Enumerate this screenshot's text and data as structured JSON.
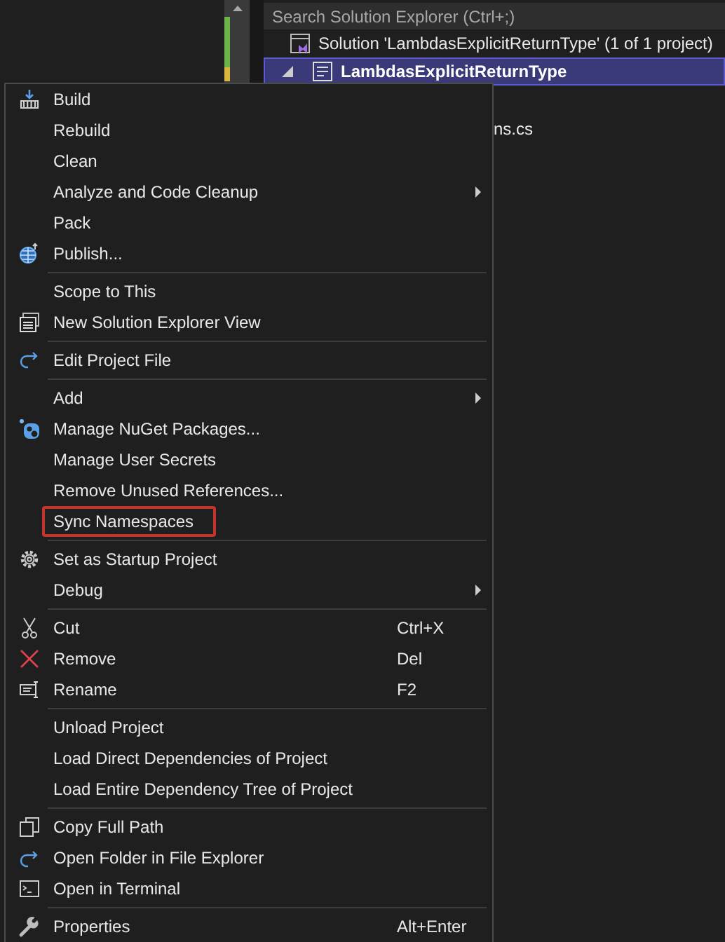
{
  "solution_explorer": {
    "search": {
      "placeholder": "Search Solution Explorer (Ctrl+;)"
    },
    "tree": [
      {
        "kind": "solution",
        "label": "Solution 'LambdasExplicitReturnType' (1 of 1 project)",
        "selected": false
      },
      {
        "kind": "project",
        "label": "LambdasExplicitReturnType",
        "selected": true,
        "expanded": true
      },
      {
        "kind": "file",
        "label": "ns.cs",
        "selected": false
      }
    ]
  },
  "context_menu": {
    "groups": [
      [
        {
          "label": "Build",
          "submenu": false,
          "outlined": false
        },
        {
          "label": "Rebuild",
          "submenu": false,
          "outlined": false
        },
        {
          "label": "Clean",
          "submenu": false,
          "outlined": false
        },
        {
          "label": "Analyze and Code Cleanup",
          "submenu": true,
          "outlined": false
        },
        {
          "label": "Pack",
          "submenu": false,
          "outlined": false
        },
        {
          "label": "Publish...",
          "submenu": false,
          "outlined": false
        }
      ],
      [
        {
          "label": "Scope to This",
          "submenu": false,
          "outlined": false
        },
        {
          "label": "New Solution Explorer View",
          "submenu": false,
          "outlined": false
        }
      ],
      [
        {
          "label": "Edit Project File",
          "submenu": false,
          "outlined": false
        }
      ],
      [
        {
          "label": "Add",
          "submenu": true,
          "outlined": false
        },
        {
          "label": "Manage NuGet Packages...",
          "submenu": false,
          "outlined": false
        },
        {
          "label": "Manage User Secrets",
          "submenu": false,
          "outlined": false
        },
        {
          "label": "Remove Unused References...",
          "submenu": false,
          "outlined": false
        },
        {
          "label": "Sync Namespaces",
          "submenu": false,
          "outlined": true
        }
      ],
      [
        {
          "label": "Set as Startup Project",
          "submenu": false,
          "outlined": false
        },
        {
          "label": "Debug",
          "submenu": true,
          "outlined": false
        }
      ],
      [
        {
          "label": "Cut",
          "shortcut": "Ctrl+X",
          "submenu": false,
          "outlined": false
        },
        {
          "label": "Remove",
          "shortcut": "Del",
          "submenu": false,
          "outlined": false
        },
        {
          "label": "Rename",
          "shortcut": "F2",
          "submenu": false,
          "outlined": false
        }
      ],
      [
        {
          "label": "Unload Project",
          "submenu": false,
          "outlined": false
        },
        {
          "label": "Load Direct Dependencies of Project",
          "submenu": false,
          "outlined": false
        },
        {
          "label": "Load Entire Dependency Tree of Project",
          "submenu": false,
          "outlined": false
        }
      ],
      [
        {
          "label": "Copy Full Path",
          "submenu": false,
          "outlined": false
        },
        {
          "label": "Open Folder in File Explorer",
          "submenu": false,
          "outlined": false
        },
        {
          "label": "Open in Terminal",
          "submenu": false,
          "outlined": false
        }
      ],
      [
        {
          "label": "Properties",
          "shortcut": "Alt+Enter",
          "submenu": false,
          "outlined": false
        }
      ]
    ]
  }
}
